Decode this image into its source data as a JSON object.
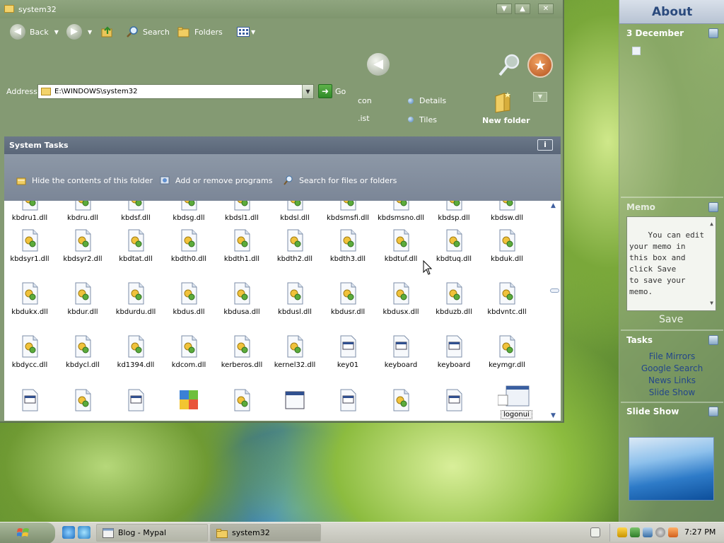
{
  "window": {
    "title": "system32",
    "toolbar": {
      "back_label": "Back",
      "search_label": "Search",
      "folders_label": "Folders"
    },
    "address": {
      "label": "Address",
      "value": "E:\\WINDOWS\\system32",
      "go_label": "Go"
    },
    "views": {
      "icon_label": "con",
      "list_label": ".ist",
      "details_label": "Details",
      "tiles_label": "Tiles",
      "new_folder_label": "New folder"
    },
    "system_tasks": {
      "title": "System Tasks",
      "items": [
        "Hide the contents of this folder",
        "Add or remove programs",
        "Search for files or folders"
      ]
    },
    "files": {
      "rows": [
        [
          "kbdru1.dll",
          "kbdru.dll",
          "kbdsf.dll",
          "kbdsg.dll",
          "kbdsl1.dll",
          "kbdsl.dll",
          "kbdsmsfi.dll",
          "kbdsmsno.dll",
          "kbdsp.dll",
          "kbdsw.dll"
        ],
        [
          "kbdsyr1.dll",
          "kbdsyr2.dll",
          "kbdtat.dll",
          "kbdth0.dll",
          "kbdth1.dll",
          "kbdth2.dll",
          "kbdth3.dll",
          "kbdtuf.dll",
          "kbdtuq.dll",
          "kbduk.dll"
        ],
        [
          "kbdukx.dll",
          "kbdur.dll",
          "kbdurdu.dll",
          "kbdus.dll",
          "kbdusa.dll",
          "kbdusl.dll",
          "kbdusr.dll",
          "kbdusx.dll",
          "kbduzb.dll",
          "kbdvntc.dll"
        ],
        [
          "kbdycc.dll",
          "kbdycl.dll",
          "kd1394.dll",
          "kdcom.dll",
          "kerberos.dll",
          "kernel32.dll",
          "key01",
          "keyboard",
          "keyboard",
          "keymgr.dll"
        ]
      ],
      "row_icons": [
        [
          "dll",
          "dll",
          "dll",
          "dll",
          "dll",
          "dll",
          "dll",
          "dll",
          "dll",
          "dll"
        ],
        [
          "dll",
          "dll",
          "dll",
          "dll",
          "dll",
          "dll",
          "dll",
          "dll",
          "dll",
          "dll"
        ],
        [
          "dll",
          "dll",
          "dll",
          "dll",
          "dll",
          "dll",
          "dll",
          "dll",
          "dll",
          "dll"
        ],
        [
          "dll",
          "dll",
          "dll",
          "dll",
          "dll",
          "dll",
          "sys",
          "sys",
          "sys",
          "dll"
        ]
      ],
      "partial_row_icons": [
        "sys",
        "dll",
        "sys",
        "puzzle",
        "dll",
        "window",
        "sys",
        "dll",
        "sys"
      ],
      "drag_label": "logonui"
    }
  },
  "sidebar": {
    "about_title": "About",
    "date": "3 December",
    "memo": {
      "title": "Memo",
      "text": "You can edit\nyour memo in\nthis box and\nclick Save\nto save your\nmemo.",
      "save_label": "Save"
    },
    "tasks": {
      "title": "Tasks",
      "links": [
        "File Mirrors",
        "Google Search",
        "News Links",
        "Slide Show"
      ]
    },
    "slideshow_title": "Slide Show"
  },
  "taskbar": {
    "tabs": [
      "Blog - Mypal",
      "system32"
    ],
    "clock": "7:27 PM"
  }
}
